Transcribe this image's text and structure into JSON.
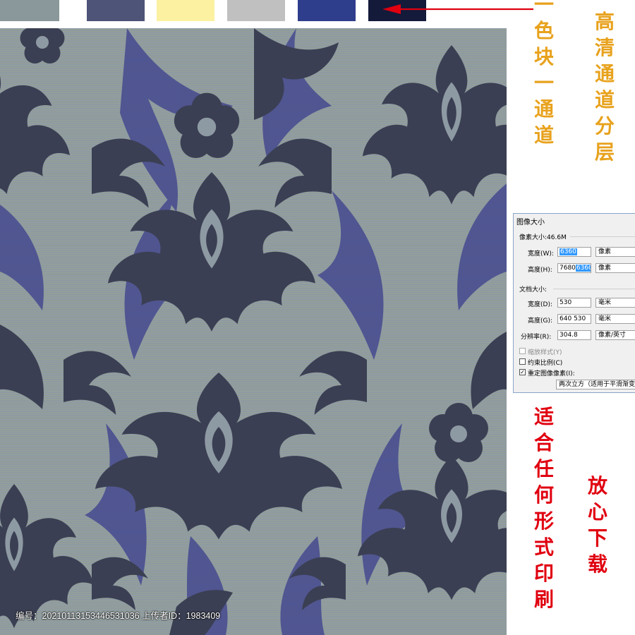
{
  "colors": {
    "swatches": [
      "#8a989b",
      "#4e5378",
      "#fbf1a0",
      "#c0c0c0",
      "#2f3d8d",
      "#131a3a"
    ],
    "arrow": "#e00010",
    "gold_text": "#e8a21d",
    "red_text": "#e00010",
    "pattern_background": "#8e9aa3",
    "pattern_dark": "#3b3f53",
    "pattern_blue": "#4d5290"
  },
  "labels": {
    "channel_note": "一色块一通道",
    "layer_note": "高清通道分层",
    "print_note": "适合任何形式印刷",
    "download_note": "放心下载"
  },
  "footer": {
    "text": "编号：20210113153446531036 上传者ID：1983409"
  },
  "dialog": {
    "title": "图像大小",
    "pixel_size_label": "像素大小:46.6M",
    "width_label": "宽度(W):",
    "width_value": "6360",
    "width_unit": "像素",
    "height_label": "高度(H):",
    "height_old": "7680",
    "height_value": "6360",
    "height_unit": "像素",
    "doc_size_label": "文档大小:",
    "doc_width_label": "宽度(D):",
    "doc_width_value": "530",
    "doc_width_unit": "毫米",
    "doc_height_label": "高度(G):",
    "doc_height_old": "640",
    "doc_height_value": "530",
    "doc_height_unit": "毫米",
    "resolution_label": "分辨率(R):",
    "resolution_value": "304.8",
    "resolution_unit": "像素/英寸",
    "scale_styles_label": "缩放样式(Y)",
    "constrain_label": "约束比例(C)",
    "resample_label": "重定图像像素(I):",
    "resample_method": "两次立方（适用于平滑渐变"
  }
}
